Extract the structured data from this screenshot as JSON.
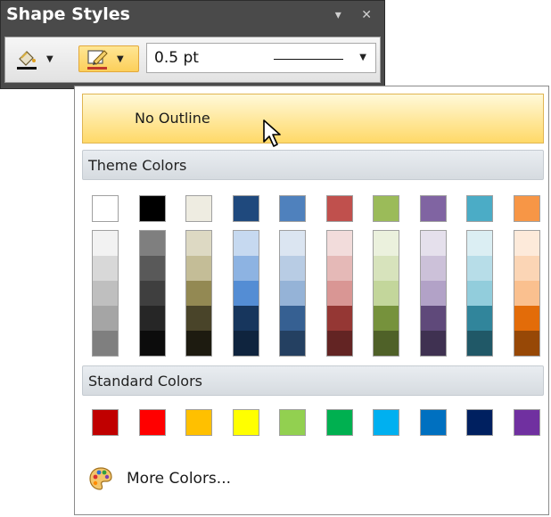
{
  "panel": {
    "title": "Shape Styles",
    "pin_icon": "pin-icon",
    "close_icon": "close-icon"
  },
  "toolbar": {
    "fill_icon": "paint-bucket-icon",
    "outline_icon": "pencil-outline-icon",
    "line_width": "0.5 pt"
  },
  "dropdown": {
    "no_outline_label": "No Outline",
    "theme_colors_label": "Theme Colors",
    "standard_colors_label": "Standard Colors",
    "more_colors_label": "More Colors...",
    "more_colors_icon": "palette-icon"
  },
  "theme_colors": [
    {
      "base": "#ffffff",
      "shades": [
        "#f2f2f2",
        "#d8d8d8",
        "#bfbfbf",
        "#a5a5a5",
        "#7f7f7f"
      ]
    },
    {
      "base": "#000000",
      "shades": [
        "#7f7f7f",
        "#595959",
        "#3f3f3f",
        "#262626",
        "#0c0c0c"
      ]
    },
    {
      "base": "#eeece1",
      "shades": [
        "#ddd9c3",
        "#c4bd97",
        "#938953",
        "#494429",
        "#1d1b10"
      ]
    },
    {
      "base": "#1f497d",
      "shades": [
        "#c6d9f0",
        "#8db3e2",
        "#548dd4",
        "#17365d",
        "#0f243e"
      ]
    },
    {
      "base": "#4f81bd",
      "shades": [
        "#dbe5f1",
        "#b8cce4",
        "#95b3d7",
        "#366092",
        "#244061"
      ]
    },
    {
      "base": "#c0504d",
      "shades": [
        "#f2dcdb",
        "#e5b9b7",
        "#d99694",
        "#953734",
        "#632423"
      ]
    },
    {
      "base": "#9bbb59",
      "shades": [
        "#ebf1dd",
        "#d7e3bc",
        "#c3d69b",
        "#76923c",
        "#4f6128"
      ]
    },
    {
      "base": "#8064a2",
      "shades": [
        "#e5e0ec",
        "#ccc1d9",
        "#b2a2c7",
        "#5f497a",
        "#3f3151"
      ]
    },
    {
      "base": "#4bacc6",
      "shades": [
        "#dbeef3",
        "#b7dde8",
        "#92cddc",
        "#31859b",
        "#205867"
      ]
    },
    {
      "base": "#f79646",
      "shades": [
        "#fdeada",
        "#fbd5b5",
        "#fac08f",
        "#e36c09",
        "#974806"
      ]
    }
  ],
  "standard_colors": [
    "#c00000",
    "#ff0000",
    "#ffc000",
    "#ffff00",
    "#92d050",
    "#00b050",
    "#00b0f0",
    "#0070c0",
    "#002060",
    "#7030a0"
  ]
}
